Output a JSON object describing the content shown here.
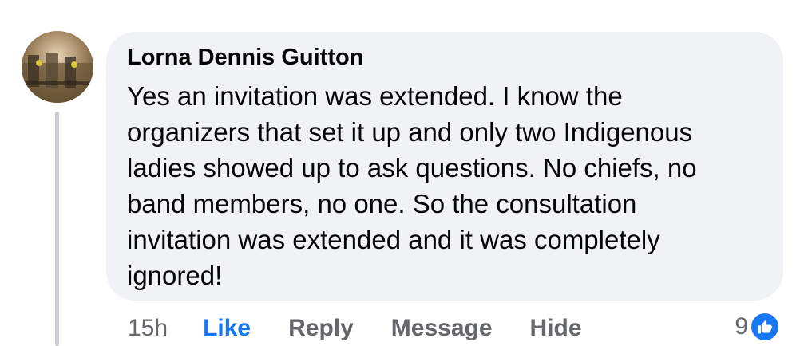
{
  "comment": {
    "author": "Lorna Dennis Guitton",
    "text_lines": [
      "Yes an invitation was extended. I know the",
      "organizers that set it up and only two Indigenous",
      "ladies showed up to ask questions. No chiefs, no",
      "band members, no one. So the consultation",
      "invitation was extended and it was completely",
      "ignored!"
    ],
    "timestamp": "15h",
    "actions": {
      "like": "Like",
      "reply": "Reply",
      "message": "Message",
      "hide": "Hide"
    },
    "reaction_count": "9",
    "reaction_icon": "thumbs-up-icon",
    "colors": {
      "accent": "#1877f2",
      "bubble": "#f0f2f5",
      "muted_text": "#65676b",
      "thread_line": "#ccd0d5"
    }
  }
}
